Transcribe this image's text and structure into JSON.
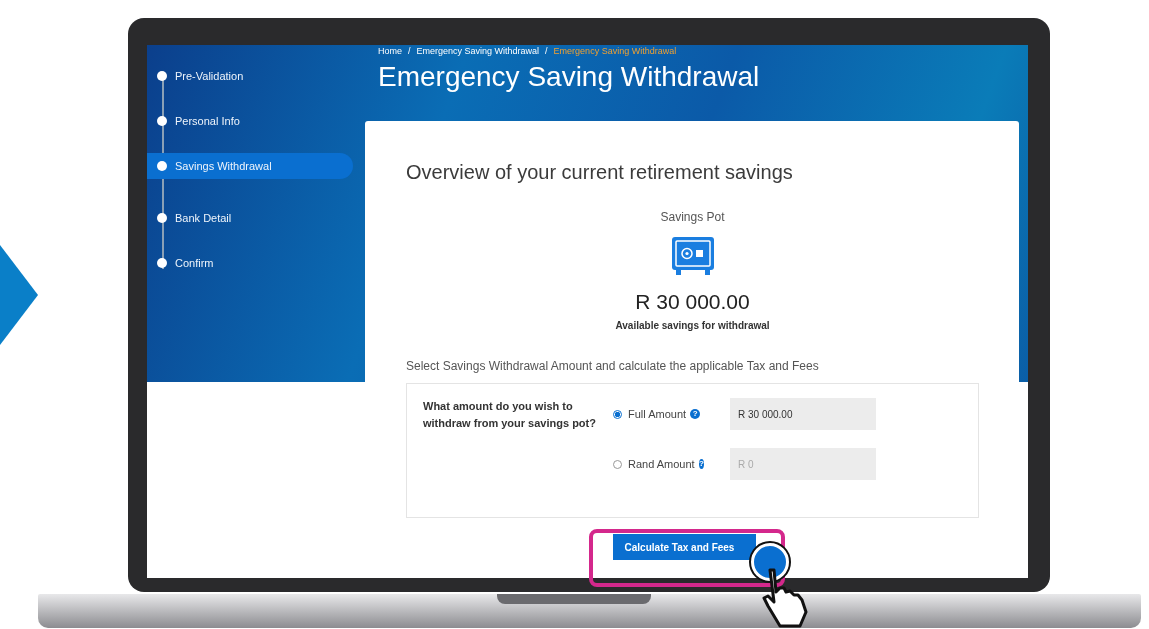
{
  "sidebar": {
    "steps": [
      {
        "label": "Pre-Validation",
        "selected": false
      },
      {
        "label": "Personal Info",
        "selected": false
      },
      {
        "label": "Savings Withdrawal",
        "selected": true
      },
      {
        "label": "Bank Detail",
        "selected": false
      },
      {
        "label": "Confirm",
        "selected": false
      }
    ]
  },
  "breadcrumb": {
    "separator": "/",
    "items": [
      {
        "label": "Home",
        "current": false
      },
      {
        "label": "Emergency Saving Withdrawal",
        "current": false
      },
      {
        "label": "Emergency Saving Withdrawal",
        "current": true
      }
    ]
  },
  "page_title": "Emergency Saving Withdrawal",
  "card": {
    "title": "Overview of your current retirement savings",
    "pot_label": "Savings Pot",
    "amount": "R 30 000.00",
    "amount_caption": "Available savings for withdrawal",
    "instruction": "Select Savings Withdrawal Amount and calculate the applicable Tax and Fees",
    "question": "What amount do you wish to withdraw from your savings pot?",
    "options": [
      {
        "label": "Full Amount",
        "help": "?",
        "selected": true,
        "value": "R 30 000.00"
      },
      {
        "label": "Rand Amount",
        "help": "?",
        "selected": false,
        "placeholder": "R 0"
      }
    ],
    "button": "Calculate Tax and Fees"
  }
}
